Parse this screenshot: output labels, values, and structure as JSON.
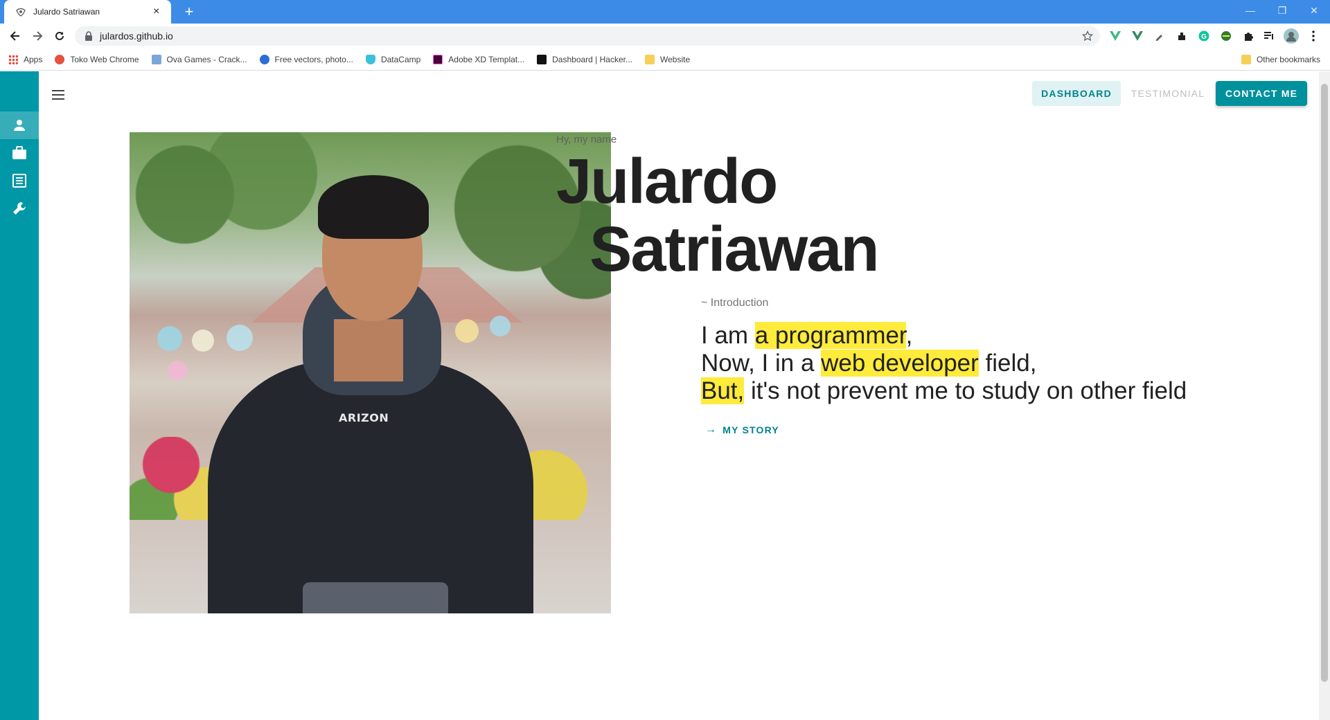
{
  "browser": {
    "tab_title": "Julardo Satriawan",
    "url": "julardos.github.io",
    "bookmarks": [
      "Apps",
      "Toko Web Chrome",
      "Ova Games - Crack...",
      "Free vectors, photo...",
      "DataCamp",
      "Adobe XD Templat...",
      "Dashboard | Hacker...",
      "Website"
    ],
    "other_bookmarks": "Other bookmarks"
  },
  "nav": {
    "dashboard": "DASHBOARD",
    "testimonial": "TESTIMONIAL",
    "contact": "CONTACT ME"
  },
  "sidebar": {
    "items": [
      "person-icon",
      "briefcase-icon",
      "list-icon",
      "wrench-icon"
    ]
  },
  "hero": {
    "greeting": "Hy, my name",
    "first_name": "Julardo",
    "last_name": "Satriawan",
    "intro_label": "~ Introduction",
    "line1_pre": "I am ",
    "line1_hl": "a programmer",
    "line1_post": ",",
    "line2_pre": "Now, I in a ",
    "line2_hl": "web developer",
    "line2_post": " field,",
    "line3_hl": "But,",
    "line3_post": " it's not prevent me to study on other field",
    "story_button": "MY STORY",
    "shirt_text": "ARIZON"
  },
  "colors": {
    "accent": "#0097a7",
    "highlight": "#ffeb3b",
    "browser_frame": "#3c8ce7"
  }
}
